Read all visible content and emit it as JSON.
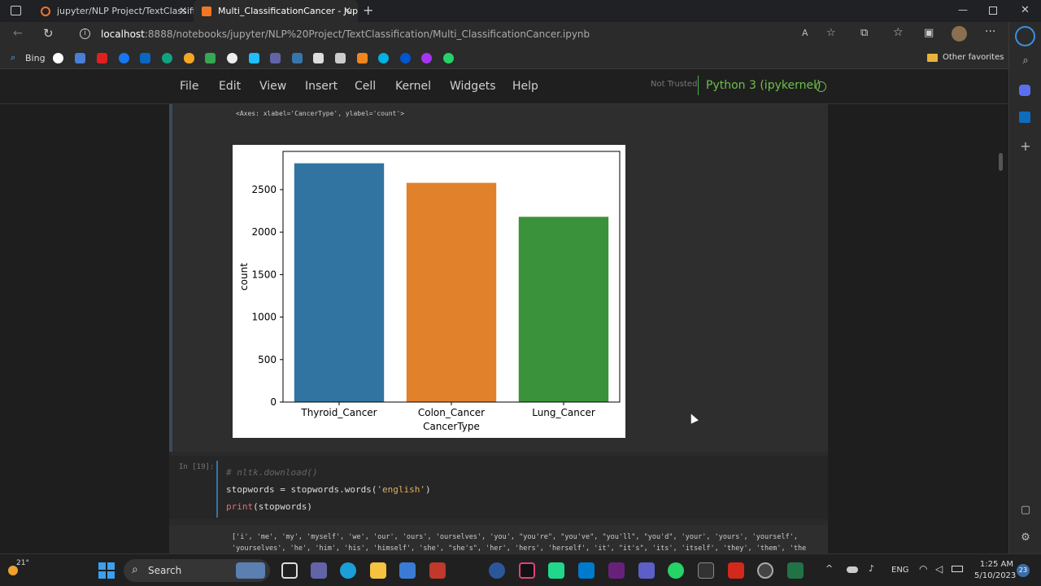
{
  "browser": {
    "tabs": [
      {
        "label": "jupyter/NLP Project/TextClassific"
      },
      {
        "label": "Multi_ClassificationCancer - Jupy"
      }
    ],
    "url_host": "localhost",
    "url_rest": ":8888/notebooks/jupyter/NLP%20Project/TextClassification/Multi_ClassificationCancer.ipynb",
    "favorites": {
      "bing_label": "Bing",
      "other_label": "Other favorites"
    }
  },
  "jupyter": {
    "menu": [
      "File",
      "Edit",
      "View",
      "Insert",
      "Cell",
      "Kernel",
      "Widgets",
      "Help"
    ],
    "trust_status": "Not Trusted",
    "kernel_name": "Python 3 (ipykernel)"
  },
  "cells": {
    "output_repr": "<Axes: xlabel='CancerType', ylabel='count'>",
    "input_prompt": "In [19]:",
    "code_line1": "# nltk.download()",
    "code_line2_a": "stopwords = stopwords.words(",
    "code_line2_str": "'english'",
    "code_line2_b": ")",
    "code_line3_fn": "print",
    "code_line3_b": "(stopwords)",
    "output_line1": "['i', 'me', 'my', 'myself', 'we', 'our', 'ours', 'ourselves', 'you', \"you're\", \"you've\", \"you'll\", \"you'd\", 'your', 'yours', 'yourself',",
    "output_line2": "'yourselves', 'he', 'him', 'his', 'himself', 'she', \"she's\", 'her', 'hers', 'herself', 'it', \"it's\", 'its', 'itself', 'they', 'them', 'the"
  },
  "chart_data": {
    "type": "bar",
    "categories": [
      "Thyroid_Cancer",
      "Colon_Cancer",
      "Lung_Cancer"
    ],
    "values": [
      2810,
      2580,
      2180
    ],
    "colors": [
      "#3274a1",
      "#e1812c",
      "#3a923a"
    ],
    "xlabel": "CancerType",
    "ylabel": "count",
    "yticks": [
      0,
      500,
      1000,
      1500,
      2000,
      2500
    ],
    "ylim": [
      0,
      2950
    ]
  },
  "taskbar": {
    "weather": "21°",
    "search_label": "Search",
    "lang": "ENG",
    "time": "1:25 AM",
    "date": "5/10/2023",
    "notif_count": "23"
  }
}
